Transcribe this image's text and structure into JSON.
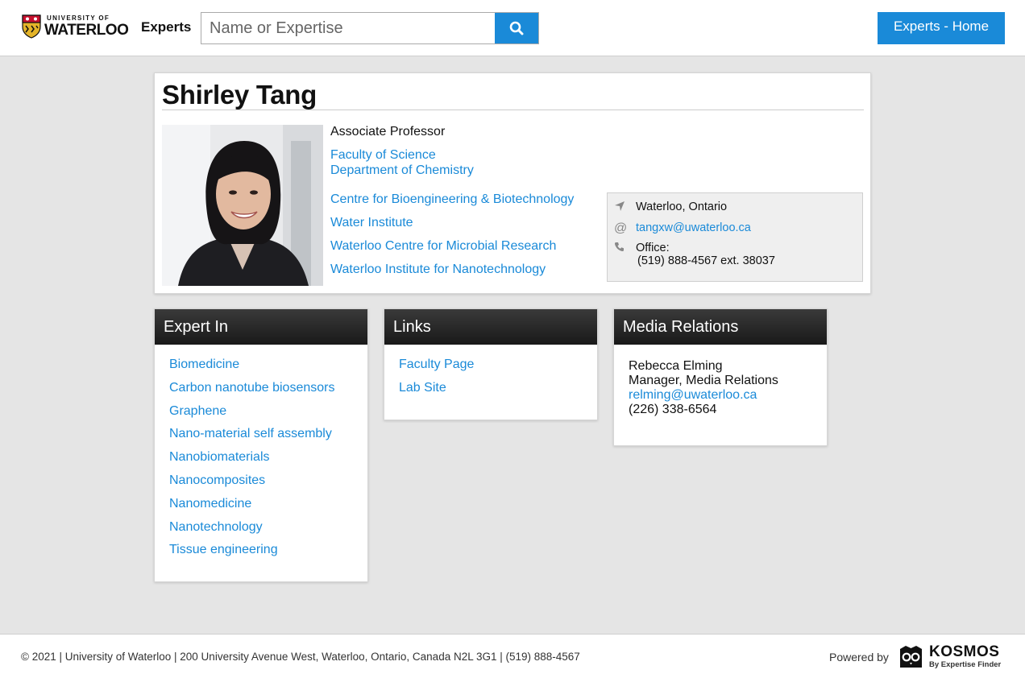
{
  "header": {
    "logo_small": "UNIVERSITY OF",
    "logo_big": "WATERLOO",
    "brand": "Experts",
    "search_placeholder": "Name or Expertise",
    "home_button": "Experts - Home"
  },
  "profile": {
    "name": "Shirley Tang",
    "title": "Associate Professor",
    "faculty": "Faculty of Science",
    "department": "Department of Chemistry",
    "affiliations": [
      "Centre for Bioengineering & Biotechnology",
      "Water Institute",
      "Waterloo Centre for Microbial Research",
      "Waterloo Institute for Nanotechnology"
    ],
    "contact": {
      "location": "Waterloo, Ontario",
      "email": "tangxw@uwaterloo.ca",
      "office_label": "Office:",
      "office_phone": "(519) 888-4567 ext. 38037"
    }
  },
  "expert_in": {
    "title": "Expert In",
    "items": [
      "Biomedicine",
      "Carbon nanotube biosensors",
      "Graphene",
      "Nano-material self assembly",
      "Nanobiomaterials",
      "Nanocomposites",
      "Nanomedicine",
      "Nanotechnology",
      "Tissue engineering"
    ]
  },
  "links": {
    "title": "Links",
    "items": [
      "Faculty Page",
      "Lab Site"
    ]
  },
  "media_relations": {
    "title": "Media Relations",
    "contact_name": "Rebecca Elming",
    "contact_role": "Manager, Media Relations",
    "contact_email": "relming@uwaterloo.ca",
    "contact_phone": "(226) 338-6564"
  },
  "footer": {
    "text": "© 2021 | University of Waterloo | 200 University Avenue West, Waterloo, Ontario, Canada N2L 3G1 | (519) 888-4567",
    "powered_by": "Powered by",
    "kosmos": "KOSMOS",
    "kosmos_sub": "By Expertise Finder"
  },
  "colors": {
    "accent": "#1a8ad8",
    "background": "#e5e5e5",
    "panel_header": "#232323"
  },
  "icons": [
    "search-icon",
    "location-arrow-icon",
    "at-icon",
    "phone-icon",
    "kosmos-owl-icon",
    "waterloo-shield-icon"
  ]
}
